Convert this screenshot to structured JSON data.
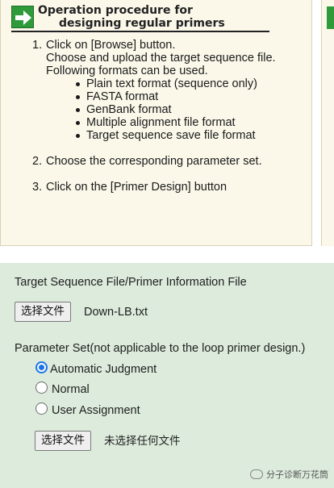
{
  "instructions": {
    "title_line1": "Operation procedure for",
    "title_line2": "designing regular primers",
    "steps": [
      {
        "num": "1.",
        "lines": [
          "Click on [Browse] button.",
          "Choose and upload the target sequence file.",
          "Following formats can be used."
        ],
        "bullets": [
          "Plain text format (sequence only)",
          "FASTA format",
          "GenBank format",
          "Multiple alignment file format",
          "Target sequence save file format"
        ]
      },
      {
        "num": "2.",
        "lines": [
          "Choose the corresponding parameter set."
        ]
      },
      {
        "num": "3.",
        "lines": [
          "Click on the [Primer Design] button"
        ]
      }
    ]
  },
  "form": {
    "target_file_label": "Target Sequence File/Primer Information File",
    "browse_button_1": "选择文件",
    "selected_file_1": "Down-LB.txt",
    "parameter_set_label": "Parameter Set(not applicable to the loop primer design.)",
    "radio_options": [
      {
        "label": "Automatic Judgment",
        "checked": true
      },
      {
        "label": "Normal",
        "checked": false
      },
      {
        "label": "User Assignment",
        "checked": false
      }
    ],
    "browse_button_2": "选择文件",
    "selected_file_2": "未选择任何文件"
  },
  "watermark": {
    "text": "分子诊断万花筒",
    "icon": "wechat-icon"
  },
  "colors": {
    "instruction_bg": "#fbf8ea",
    "form_bg": "#dcebdc",
    "accent_green": "#2e9a3a",
    "radio_blue": "#1a73e8"
  }
}
